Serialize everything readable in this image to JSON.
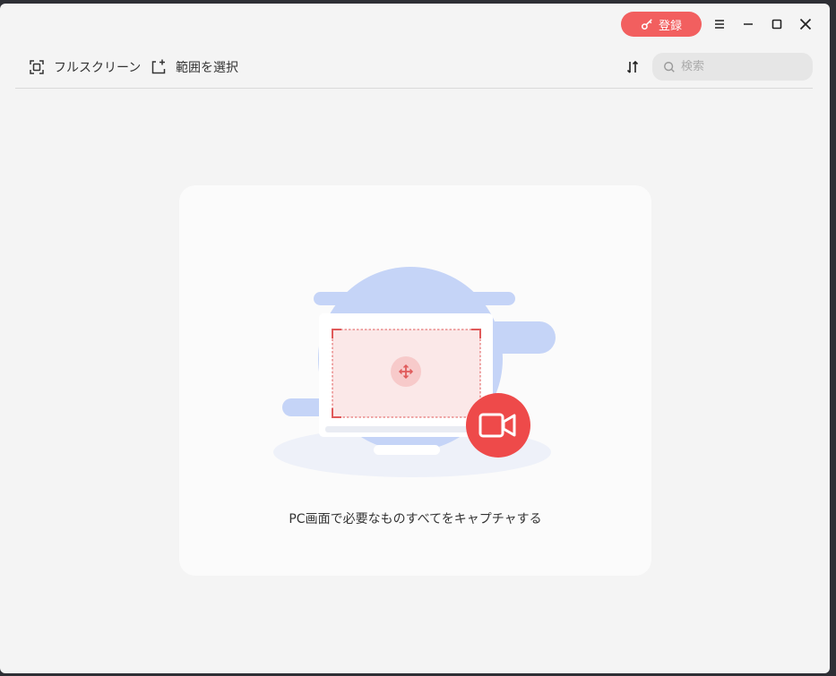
{
  "titlebar": {
    "register_label": "登録",
    "menu_icon": "hamburger-icon",
    "minimize_icon": "minimize-icon",
    "maximize_icon": "maximize-icon",
    "close_icon": "close-icon"
  },
  "toolbar": {
    "fullscreen_label": "フルスクリーン",
    "region_label": "範囲を選択",
    "sort_icon": "sort-icon",
    "search_placeholder": "検索"
  },
  "empty_state": {
    "caption": "PC画面で必要なものすべてをキャプチャする"
  },
  "colors": {
    "accent": "#f25f5f",
    "record_red": "#ee4a4a",
    "blob_blue": "#c5d4f7",
    "background": "#f4f4f4",
    "card": "#fbfbfb"
  }
}
